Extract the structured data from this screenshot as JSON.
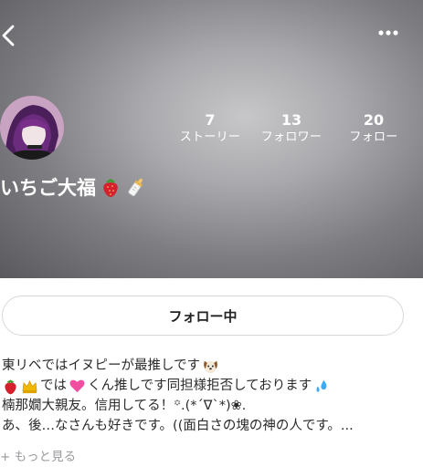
{
  "profile": {
    "name": "いちご大福",
    "name_emojis": [
      "strawberry-icon",
      "baby-bottle-icon"
    ]
  },
  "stats": [
    {
      "value": "7",
      "label": "ストーリー"
    },
    {
      "value": "13",
      "label": "フォロワー"
    },
    {
      "value": "20",
      "label": "フォロー"
    }
  ],
  "follow_button": {
    "label": "フォロー中"
  },
  "bio": {
    "line1": "東リベではイヌピーが最推しです",
    "line2_a": "では",
    "line2_b": "くん推しです同担様拒否しております",
    "line3": "楠那嫺大親友。信用してる！꙳.(*´∇`*)❀.",
    "line4": "あ、後…なさんも好きです。((面白さの塊の神の人です。..."
  },
  "see_more": {
    "label": "+ もっと見る"
  },
  "colors": {
    "header_gradient_center": "#c7c7c9",
    "header_gradient_edge": "#5a5a5e",
    "button_border": "#d8d8dc",
    "see_more": "#9a9a9e"
  }
}
